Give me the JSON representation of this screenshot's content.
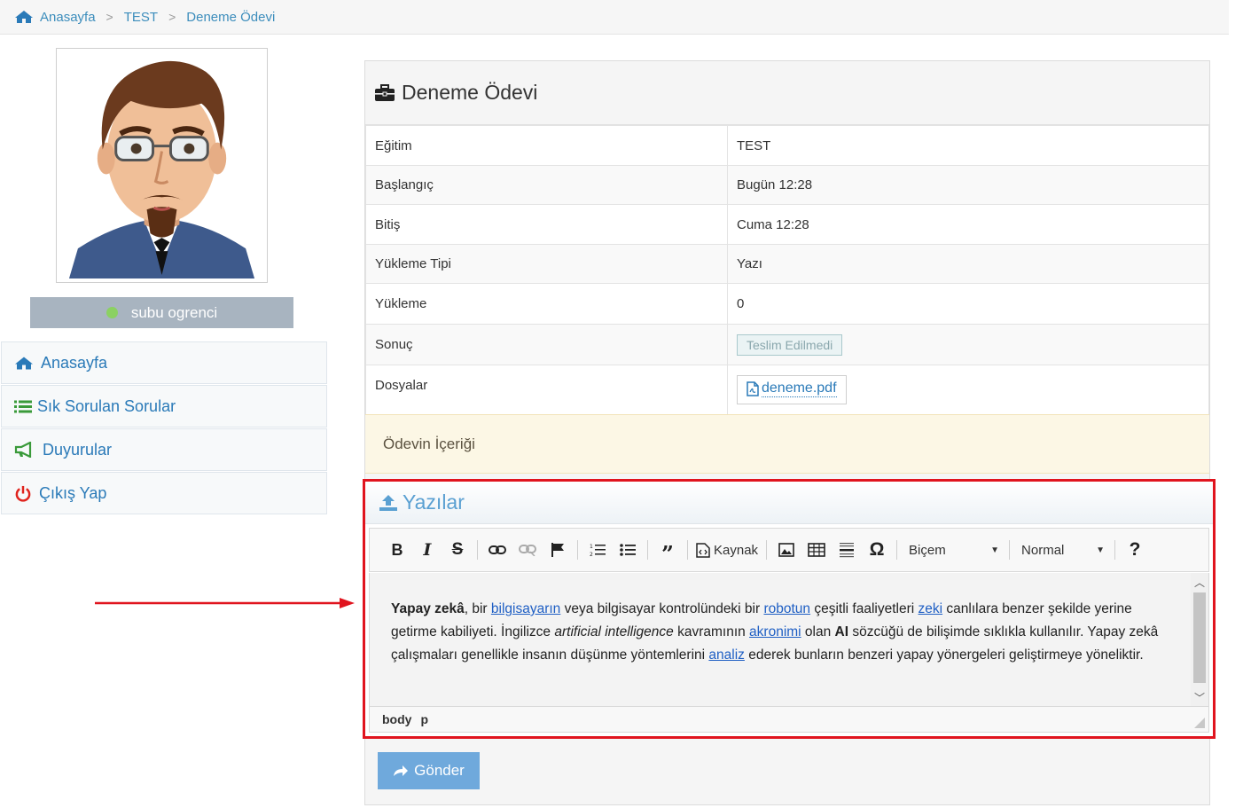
{
  "breadcrumb": {
    "items": [
      "Anasayfa",
      "TEST",
      "Deneme Ödevi"
    ]
  },
  "user": {
    "name": "subu ogrenci"
  },
  "sidebar": {
    "items": [
      {
        "label": "Anasayfa",
        "icon": "home-icon"
      },
      {
        "label": "Sık Sorulan Sorular",
        "icon": "list-icon"
      },
      {
        "label": "Duyurular",
        "icon": "megaphone-icon"
      },
      {
        "label": "Çıkış Yap",
        "icon": "power-icon"
      }
    ]
  },
  "assignment": {
    "title": "Deneme Ödevi",
    "rows": [
      {
        "key": "Eğitim",
        "value": "TEST"
      },
      {
        "key": "Başlangıç",
        "value": "Bugün 12:28"
      },
      {
        "key": "Bitiş",
        "value": "Cuma 12:28"
      },
      {
        "key": "Yükleme Tipi",
        "value": "Yazı"
      },
      {
        "key": "Yükleme",
        "value": "0"
      },
      {
        "key": "Sonuç",
        "value": "Teslim Edilmedi"
      },
      {
        "key": "Dosyalar",
        "value": "deneme.pdf"
      }
    ],
    "content_label": "Ödevin İçeriği"
  },
  "editor": {
    "title": "Yazılar",
    "toolbar": {
      "source_label": "Kaynak",
      "format_label": "Biçem",
      "style_label": "Normal",
      "help_label": "?"
    },
    "text": {
      "p1_bold": "Yapay zekâ",
      "p1_a": ", bir ",
      "link1": "bilgisayarın",
      "p1_b": " veya bilgisayar kontrolündeki bir ",
      "link2": "robotun",
      "p1_c": " çeşitli faaliyetleri ",
      "link3": "zeki",
      "p1_d": " canlılara benzer şekilde yerine getirme kabiliyeti. İngilizce ",
      "italic": "artificial intelligence",
      "p1_e": " kavramının ",
      "link4": "akronimi",
      "p1_f": " olan ",
      "bold2": "AI",
      "p1_g": " sözcüğü de bilişimde sıklıkla kullanılır. Yapay zekâ çalışmaları genellikle insanın düşünme yöntemlerini ",
      "link5": "analiz",
      "p1_h": " ederek bunların benzeri yapay yönergeleri geliştirmeye yöneliktir."
    },
    "path": [
      "body",
      "p"
    ]
  },
  "send_label": "Gönder",
  "colors": {
    "link": "#2a7ab8",
    "highlight_border": "#e0141e",
    "button": "#6fa9dc"
  }
}
